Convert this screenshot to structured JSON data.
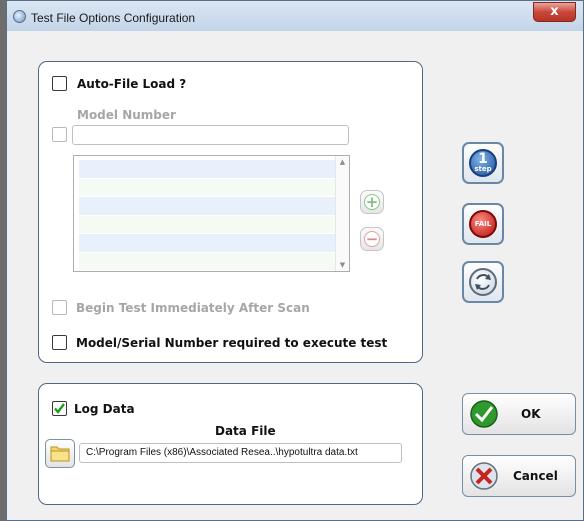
{
  "window": {
    "title": "Test File Options Configuration",
    "close_glyph": "x"
  },
  "auto_file": {
    "auto_file_load_label": "Auto-File Load ?",
    "model_number_label": "Model Number",
    "model_number_value": "",
    "list_items": [
      "",
      "",
      "",
      "",
      "",
      ""
    ],
    "add_glyph": "+",
    "remove_glyph": "−",
    "begin_test_label": "Begin Test Immediately After Scan",
    "serial_required_label": "Model/Serial Number required to execute test"
  },
  "log": {
    "log_data_label": "Log Data",
    "log_data_checked": true,
    "data_file_label": "Data File",
    "data_file_path": "C:\\Program Files (x86)\\Associated Resea..\\hypotultra data.txt"
  },
  "side_buttons": {
    "step_icon": "1-step-icon",
    "fail_icon": "fail-icon",
    "cycle_icon": "cycle-icon",
    "step_icon_text": "1",
    "step_icon_sub": "step",
    "fail_icon_text": "FAIL"
  },
  "actions": {
    "ok_label": "OK",
    "cancel_label": "Cancel"
  },
  "colors": {
    "group_border": "#4c6a86",
    "list_row_blue": "#e8f0fb",
    "list_row_green": "#f4fbf2",
    "ok_green": "#2e9a2e",
    "cancel_red": "#c6251d"
  }
}
